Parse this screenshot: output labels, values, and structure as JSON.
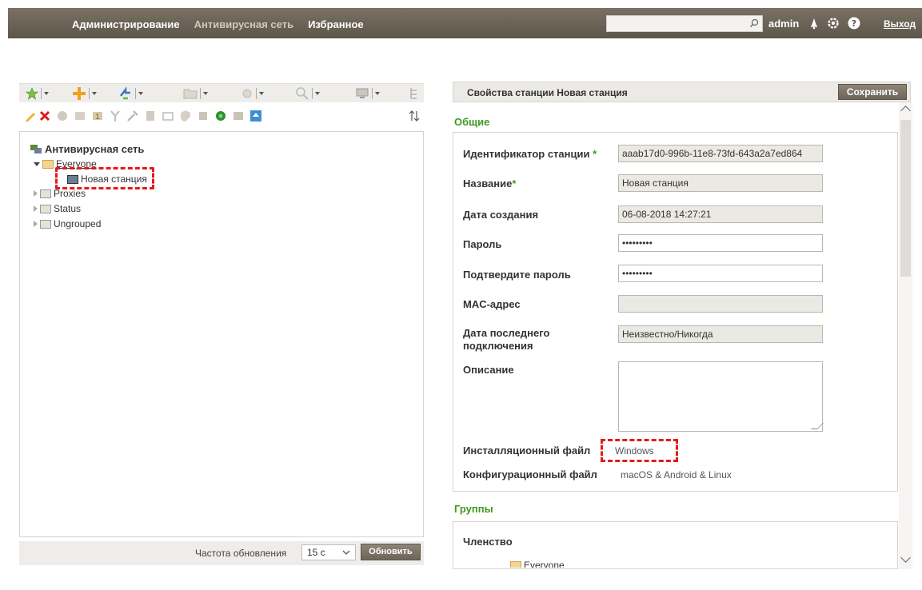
{
  "topbar": {
    "nav": [
      "Администрирование",
      "Антивирусная сеть",
      "Избранное"
    ],
    "search_placeholder": "",
    "user": "admin",
    "logout": "Выход",
    "bg": "#6b6357"
  },
  "tree": {
    "root": "Антивирусная сеть",
    "items": [
      {
        "label": "Everyone",
        "expanded": true
      },
      {
        "label": "Новая станция"
      },
      {
        "label": "Proxies"
      },
      {
        "label": "Status"
      },
      {
        "label": "Ungrouped"
      }
    ]
  },
  "footer": {
    "freq_label": "Частота обновления",
    "freq_value": "15 с",
    "refresh": "Обновить"
  },
  "props": {
    "title": "Свойства станции Новая станция",
    "save": "Сохранить",
    "section_general": "Общие",
    "fields": {
      "id_label": "Идентификатор станции",
      "id_value": "aaab17d0-996b-11e8-73fd-643a2a7ed864",
      "name_label": "Название",
      "name_value": "Новая станция",
      "created_label": "Дата создания",
      "created_value": "06-08-2018 14:27:21",
      "password_label": "Пароль",
      "password_value": "•••••••••",
      "confirm_label": "Подтвердите пароль",
      "confirm_value": "•••••••••",
      "mac_label": "MAC-адрес",
      "mac_value": "",
      "lastconn_label_1": "Дата последнего",
      "lastconn_label_2": "подключения",
      "lastconn_value": "Неизвестно/Никогда",
      "desc_label": "Описание",
      "install_label": "Инсталляционный файл",
      "install_value": "Windows",
      "config_label": "Конфигурационный файл",
      "config_value": "macOS & Android & Linux"
    },
    "section_groups": "Группы",
    "membership_label": "Членство",
    "membership_item": "Everyone",
    "required_mark": "*"
  },
  "colors": {
    "accent_green": "#3c9a1f",
    "highlight_red": "#e41b17"
  }
}
